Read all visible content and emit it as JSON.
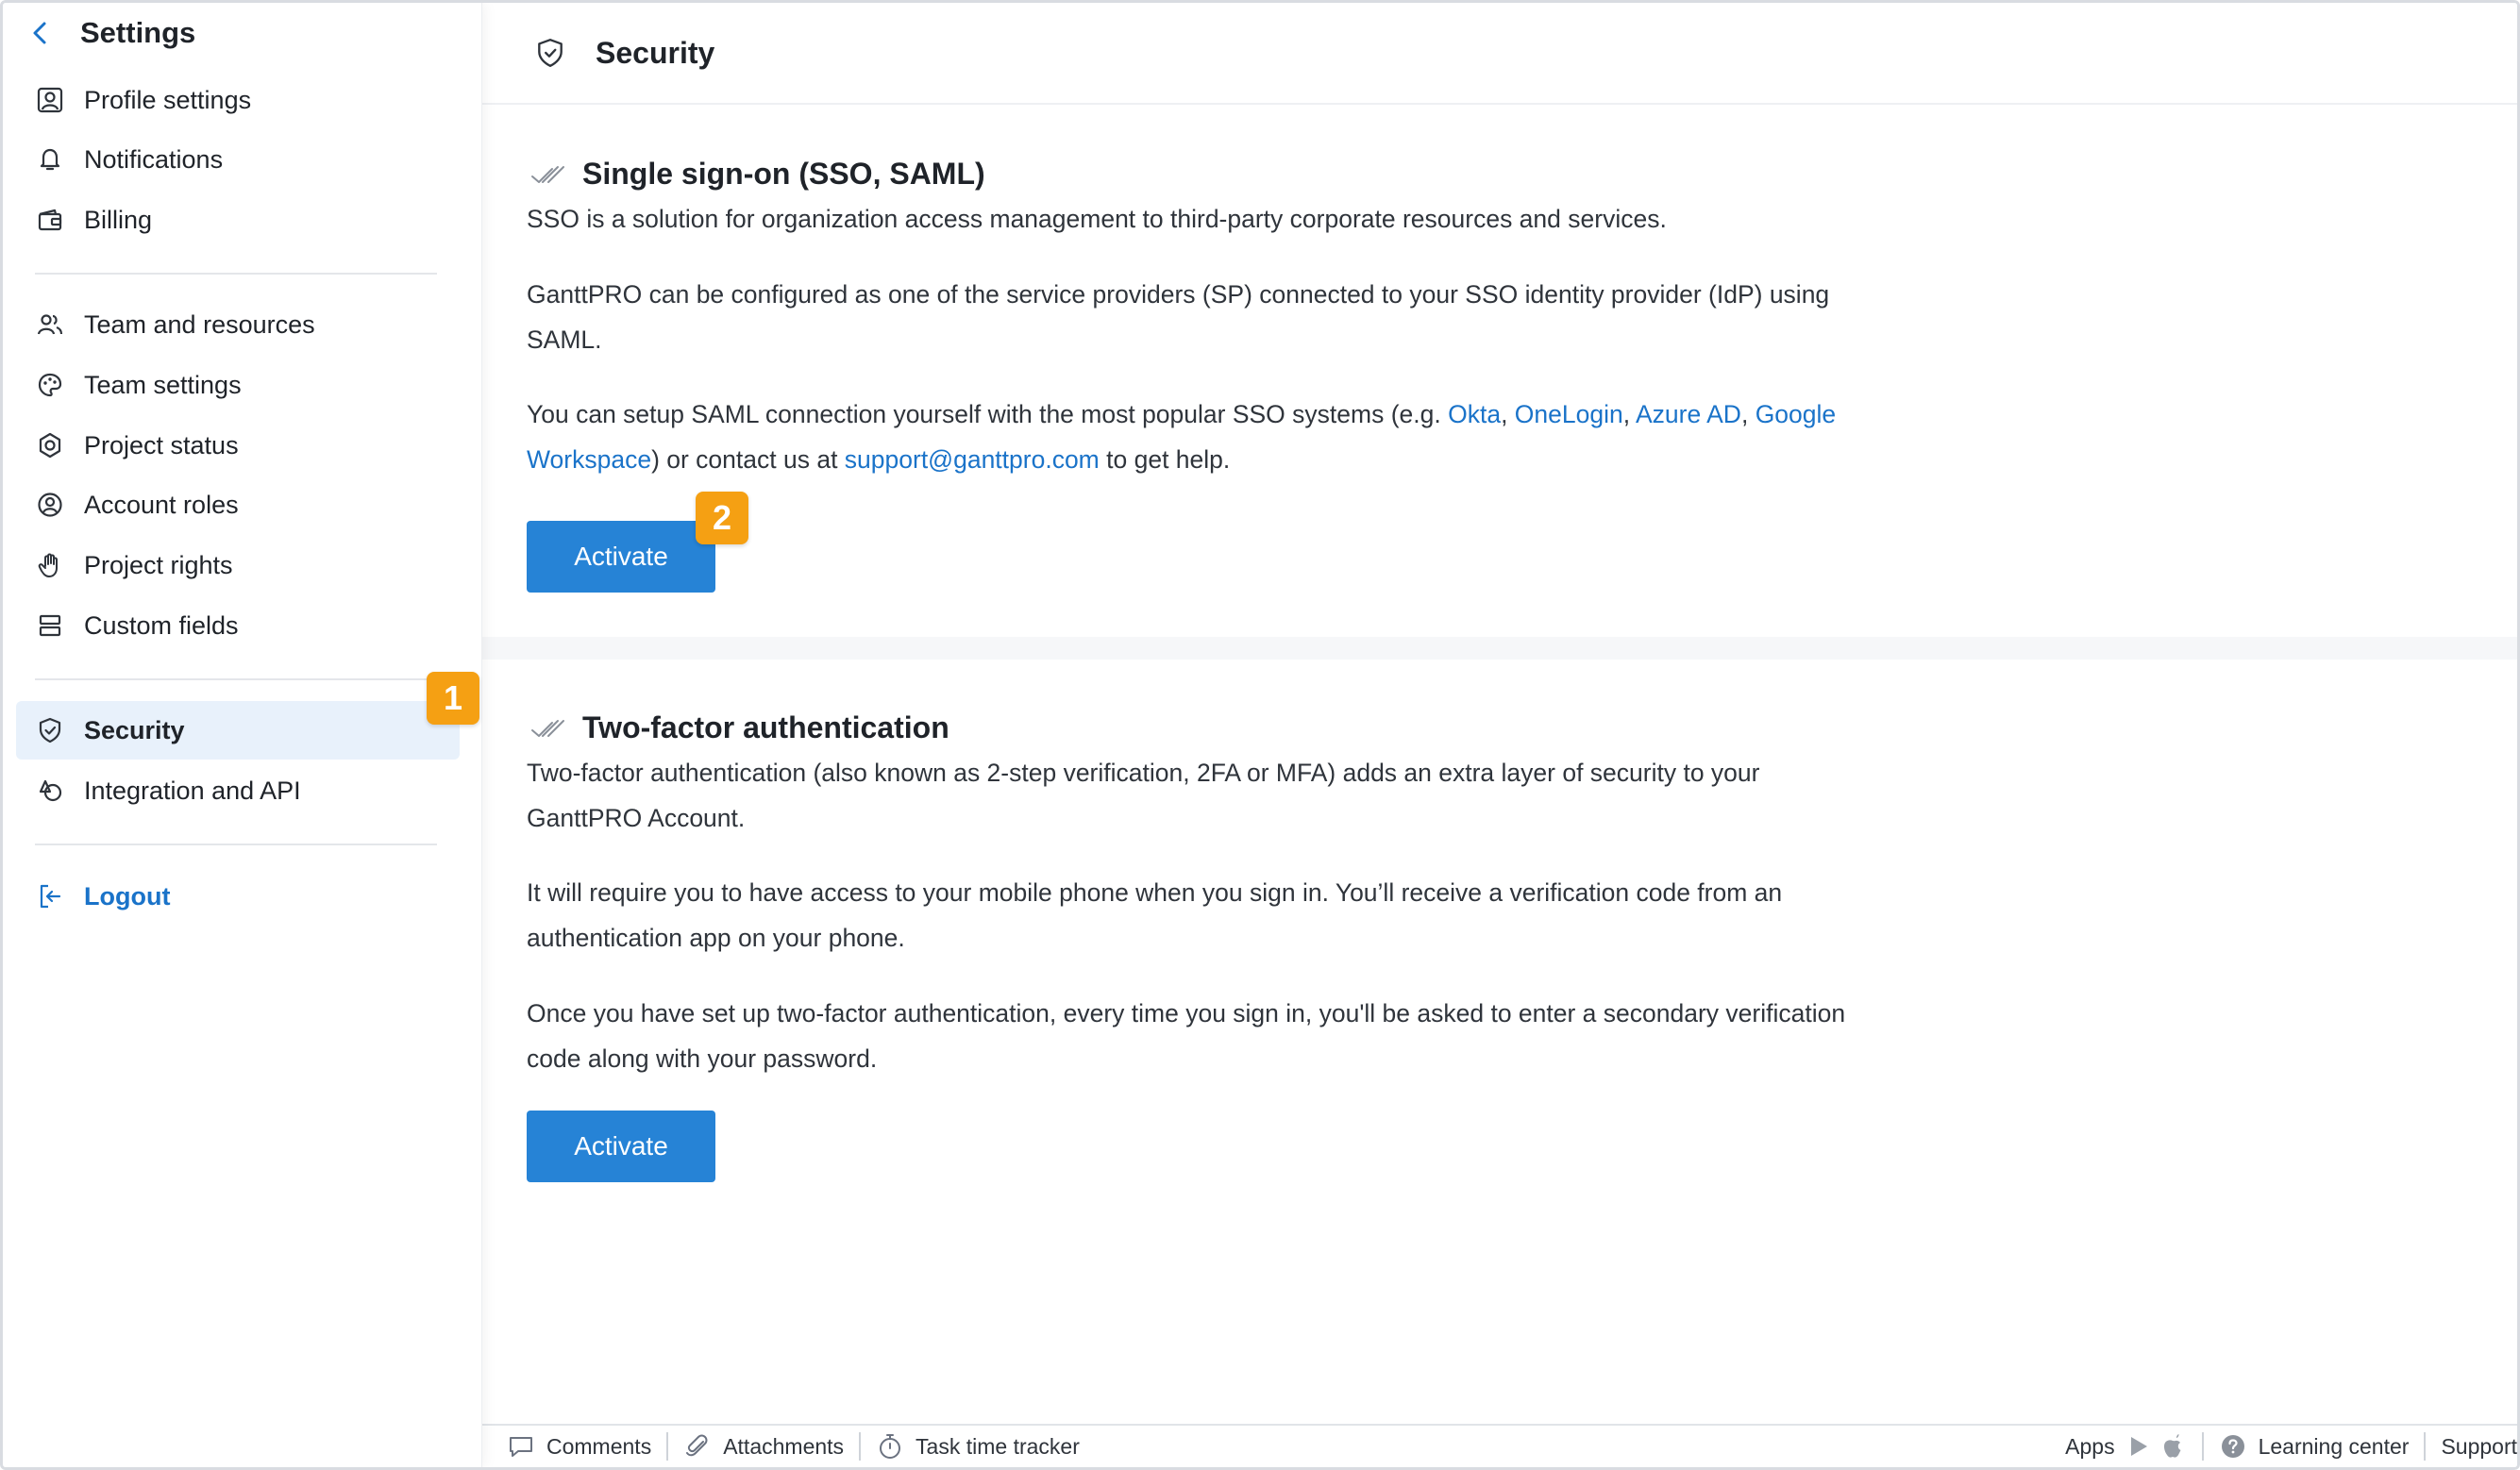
{
  "sidebar": {
    "title": "Settings",
    "items": [
      {
        "label": "Profile settings",
        "icon": "user-square-icon"
      },
      {
        "label": "Notifications",
        "icon": "bell-icon"
      },
      {
        "label": "Billing",
        "icon": "wallet-icon"
      },
      {
        "label": "Team and resources",
        "icon": "users-icon"
      },
      {
        "label": "Team settings",
        "icon": "palette-icon"
      },
      {
        "label": "Project status",
        "icon": "target-icon"
      },
      {
        "label": "Account roles",
        "icon": "user-circle-icon"
      },
      {
        "label": "Project rights",
        "icon": "hand-icon"
      },
      {
        "label": "Custom fields",
        "icon": "list-fields-icon"
      },
      {
        "label": "Security",
        "icon": "shield-icon",
        "active": true
      },
      {
        "label": "Integration and API",
        "icon": "integration-icon"
      }
    ],
    "logout_label": "Logout"
  },
  "badges": {
    "one": "1",
    "two": "2"
  },
  "main": {
    "title": "Security",
    "sso": {
      "title": "Single sign-on (SSO, SAML)",
      "p1": "SSO is a solution for organization access management to third-party corporate resources and services.",
      "p2_line1": "GanttPRO can be configured as one of the service providers (SP) connected to your SSO identity provider (IdP) using",
      "p2_line2": "SAML.",
      "p3_prefix": "You can setup SAML connection yourself with the most popular SSO systems (e.g. ",
      "link_okta": "Okta",
      "link_onelogin": "OneLogin",
      "link_azure": "Azure AD",
      "link_google_1": "Google",
      "link_google_2": "Workspace",
      "p3_mid": ") or contact us at ",
      "link_email": "support@ganttpro.com",
      "p3_suffix": " to get help.",
      "button": "Activate"
    },
    "tfa": {
      "title": "Two-factor authentication",
      "p1_line1": "Two-factor authentication (also known as 2-step verification, 2FA or MFA) adds an extra layer of security to your",
      "p1_line2": "GanttPRO Account.",
      "p2_line1": "It will require you to have access to your mobile phone when you sign in. You’ll receive a verification code from an",
      "p2_line2": "authentication app on your phone.",
      "p3_line1": "Once you have set up two-factor authentication, every time you sign in, you'll be asked to enter a secondary verification",
      "p3_line2": "code along with your password.",
      "button": "Activate"
    }
  },
  "footer": {
    "comments": "Comments",
    "attachments": "Attachments",
    "time_tracker": "Task time tracker",
    "apps": "Apps",
    "learning_center": "Learning center",
    "support": "Support"
  },
  "colors": {
    "accent": "#2683d6",
    "link": "#1a73c9",
    "badge": "#f5a013",
    "active_bg": "#e8f1fb"
  }
}
